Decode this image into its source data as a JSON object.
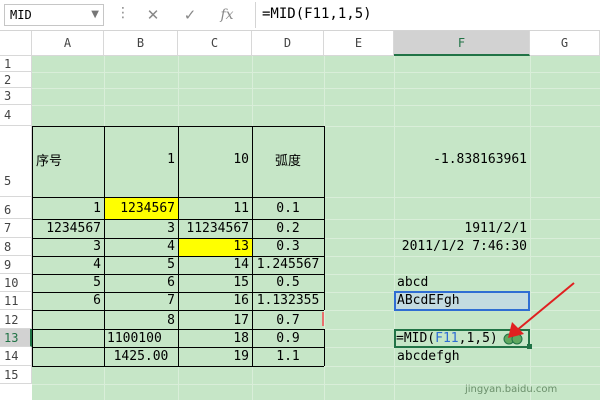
{
  "formula_bar": {
    "name_box": "MID",
    "cancel_symbol": "✕",
    "enter_symbol": "✓",
    "fx_symbol": "fx",
    "formula": "=MID(F11,1,5)"
  },
  "columns": [
    "A",
    "B",
    "C",
    "D",
    "E",
    "F",
    "G"
  ],
  "selected_column": "F",
  "rows": [
    "1",
    "2",
    "3",
    "4",
    "5",
    "6",
    "7",
    "8",
    "9",
    "10",
    "11",
    "12",
    "13",
    "14",
    "15"
  ],
  "selected_row": "13",
  "cells": {
    "A5": "序号",
    "B5": "1",
    "C5": "10",
    "D5": "弧度",
    "F5": "-1.838163961",
    "A6": "1",
    "B6": "1234567",
    "C6": "11",
    "D6": "0.1",
    "A7": "1234567",
    "B7": "3",
    "C7": "11234567",
    "D7": "0.2",
    "F7": "1911/2/1",
    "A8": "3",
    "B8": "4",
    "C8": "13",
    "D8": "0.3",
    "F8": "2011/1/2 7:46:30",
    "A9": "4",
    "B9": "5",
    "C9": "14",
    "D9": "1.245567",
    "A10": "5",
    "B10": "6",
    "C10": "15",
    "D10": "0.5",
    "F10": "abcd",
    "A11": "6",
    "B11": "7",
    "C11": "16",
    "D11": "1.132355",
    "F11": "ABcdEFgh",
    "B12": "8",
    "C12": "17",
    "D12": "0.7",
    "B13": "1100100",
    "C13": "18",
    "D13": "0.9",
    "B14": "1425.00",
    "C14": "19",
    "D14": "1.1",
    "F14": "abcdefgh"
  },
  "edit_cell": {
    "prefix": "=MID(",
    "ref": "F11",
    "suffix": ",1,5)"
  },
  "highlight_color": "#ffff00",
  "grid_color": "#c6e6c7",
  "accent_color": "#217346",
  "ref_color": "#2f6dd3",
  "arrow_color": "#e02020",
  "watermark": "jingyan.baidu.com"
}
